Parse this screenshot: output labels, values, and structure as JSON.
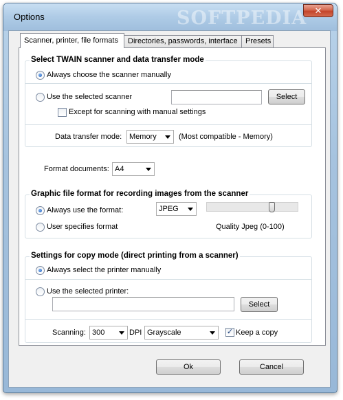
{
  "window": {
    "title": "Options",
    "watermark": "SOFTPEDIA",
    "close_symbol": "✕"
  },
  "tabs": [
    {
      "label": "Scanner, printer, file formats",
      "active": true
    },
    {
      "label": "Directories, passwords, interface",
      "active": false
    },
    {
      "label": "Presets",
      "active": false
    }
  ],
  "twain": {
    "title": "Select TWAIN scanner and data transfer mode",
    "always_manual_label": "Always choose the scanner manually",
    "use_selected_label": "Use the selected scanner",
    "selected_scanner_value": "",
    "select_button": "Select",
    "except_manual_label": "Except for scanning with manual settings",
    "transfer_mode_label": "Data transfer mode:",
    "transfer_mode_value": "Memory",
    "transfer_mode_hint": "(Most compatible - Memory)"
  },
  "format_documents": {
    "label": "Format documents:",
    "value": "A4"
  },
  "graphic": {
    "title": "Graphic file format for recording images from the scanner",
    "always_format_label": "Always use the format:",
    "format_value": "JPEG",
    "user_format_label": "User specifies format",
    "quality_label": "Quality Jpeg (0-100)",
    "quality_fraction": 0.73
  },
  "copy_mode": {
    "title": "Settings for copy mode (direct printing from a scanner)",
    "always_printer_label": "Always select the printer manually",
    "use_printer_label": "Use the selected printer:",
    "selected_printer_value": "",
    "select_button": "Select",
    "scanning_label": "Scanning:",
    "dpi_value": "300",
    "dpi_unit": "DPI",
    "color_value": "Grayscale",
    "keep_copy_label": "Keep a copy",
    "keep_copy_checked": true
  },
  "footer": {
    "ok_label": "Ok",
    "cancel_label": "Cancel"
  },
  "colors": {
    "title_bar": "#aecbe6",
    "close_button": "#c4442a",
    "radio_dot": "#1e5bb8"
  }
}
